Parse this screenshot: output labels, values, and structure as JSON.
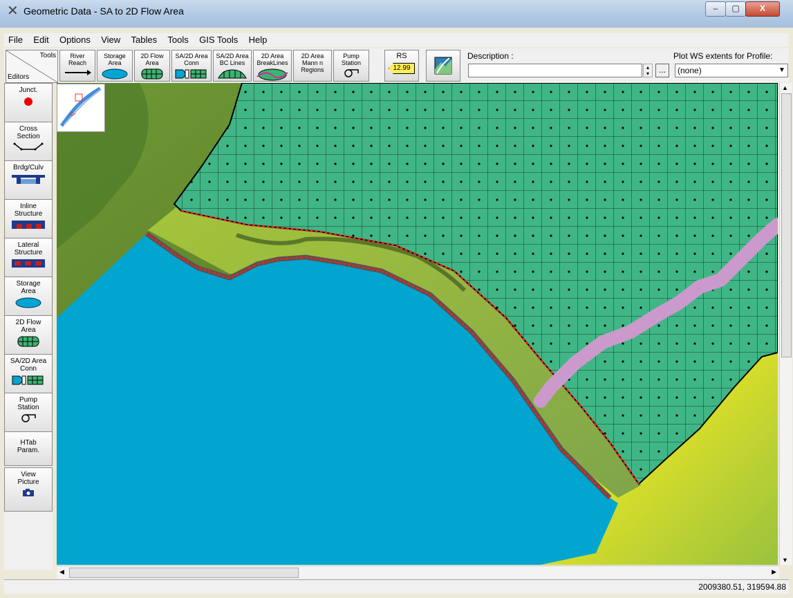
{
  "window": {
    "title": "Geometric Data - SA to 2D Flow Area",
    "min_glyph": "–",
    "max_glyph": "▢",
    "close_glyph": "X"
  },
  "menu": [
    "File",
    "Edit",
    "Options",
    "View",
    "Tables",
    "Tools",
    "GIS Tools",
    "Help"
  ],
  "toolbar": {
    "tools_label": "Tools",
    "editors_label": "Editors",
    "buttons": [
      {
        "label1": "River",
        "label2": "Reach"
      },
      {
        "label1": "Storage",
        "label2": "Area"
      },
      {
        "label1": "2D Flow",
        "label2": "Area"
      },
      {
        "label1": "SA/2D Area",
        "label2": "Conn"
      },
      {
        "label1": "SA/2D Area",
        "label2": "BC Lines"
      },
      {
        "label1": "2D Area",
        "label2": "BreakLines"
      },
      {
        "label1": "2D Area",
        "label2": "Mann n",
        "label3": "Regions"
      },
      {
        "label1": "Pump",
        "label2": "Station"
      }
    ],
    "rs_label": "RS",
    "rs_value": "12.99",
    "description_label": "Description :",
    "description_value": "",
    "dots_label": "...",
    "plot_label": "Plot WS extents for Profile:",
    "plot_value": "(none)"
  },
  "sidebar": [
    {
      "label1": "Junct."
    },
    {
      "label1": "Cross",
      "label2": "Section"
    },
    {
      "label1": "Brdg/Culv"
    },
    {
      "label1": "Inline",
      "label2": "Structure"
    },
    {
      "label1": "Lateral",
      "label2": "Structure"
    },
    {
      "label1": "Storage",
      "label2": "Area"
    },
    {
      "label1": "2D Flow",
      "label2": "Area"
    },
    {
      "label1": "SA/2D Area",
      "label2": "Conn"
    },
    {
      "label1": "Pump",
      "label2": "Station"
    },
    {
      "label1": "HTab",
      "label2": "Param."
    },
    {
      "label1": "View",
      "label2": "Picture"
    }
  ],
  "colors": {
    "storage_area": "#02a5cf",
    "mesh": "#40b686",
    "manning_region": "#cc99cc",
    "bc_line": "#e8231c"
  },
  "status": {
    "coords": "2009380.51, 319594.88"
  }
}
